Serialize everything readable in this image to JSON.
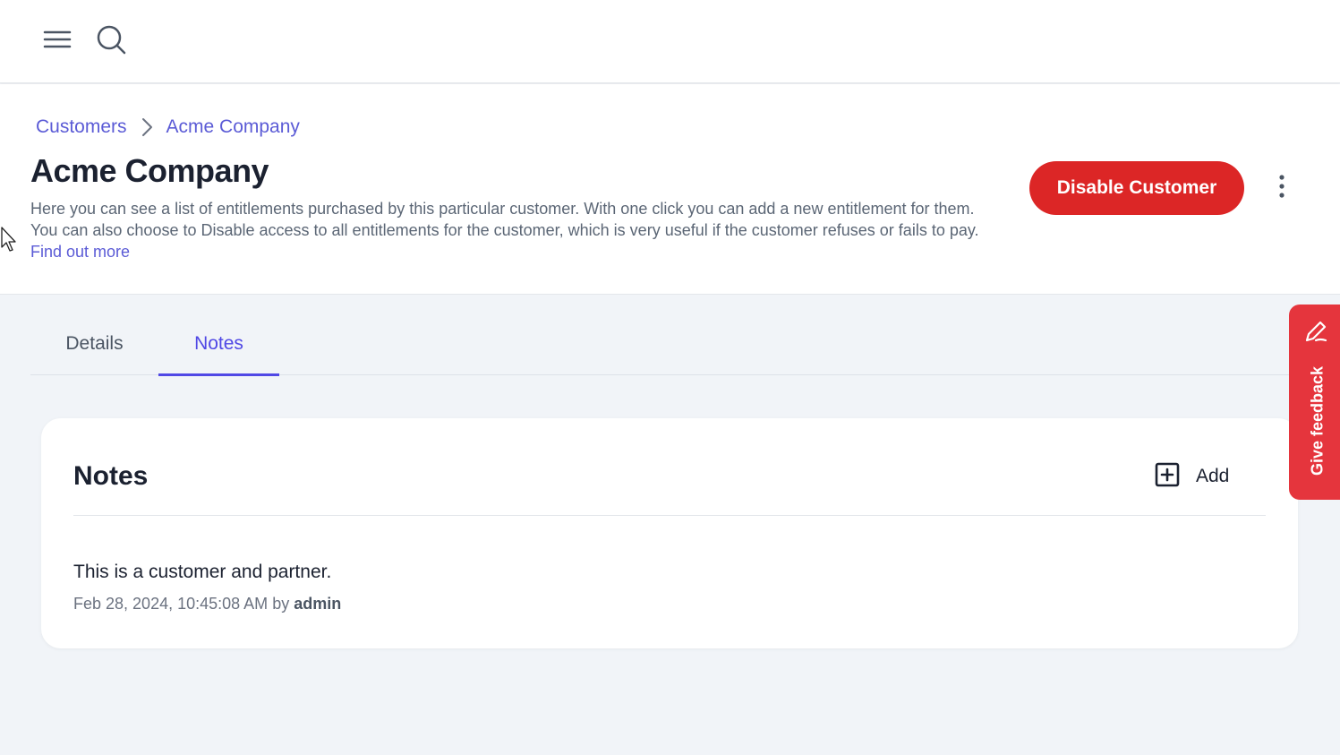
{
  "topbar": {
    "menu_icon": "hamburger-menu-icon",
    "search_icon": "search-icon"
  },
  "breadcrumb": {
    "items": [
      "Customers",
      "Acme Company"
    ],
    "separator_icon": "chevron-right-icon"
  },
  "header": {
    "title": "Acme Company",
    "description": "Here you can see a list of entitlements purchased by this particular customer. With one click you can add a new entitlement for them. You can also choose to Disable access to all entitlements for the customer, which is very useful if the customer refuses or fails to pay.",
    "find_out_more": "Find out more",
    "disable_button": "Disable Customer",
    "more_icon": "kebab-menu-icon"
  },
  "tabs": [
    {
      "label": "Details",
      "active": false
    },
    {
      "label": "Notes",
      "active": true
    }
  ],
  "notes_card": {
    "title": "Notes",
    "add_label": "Add",
    "add_icon": "plus-square-icon",
    "notes": [
      {
        "text": "This is a customer and partner.",
        "timestamp": "Feb 28, 2024, 10:45:08 AM",
        "by": "by",
        "author": "admin"
      }
    ]
  },
  "feedback": {
    "label": "Give feedback",
    "icon": "pencil-icon"
  },
  "colors": {
    "accent": "#5048e5",
    "link": "#5b5bd6",
    "danger": "#dc2626",
    "feedback": "#e5353d",
    "background": "#f1f4f8"
  }
}
